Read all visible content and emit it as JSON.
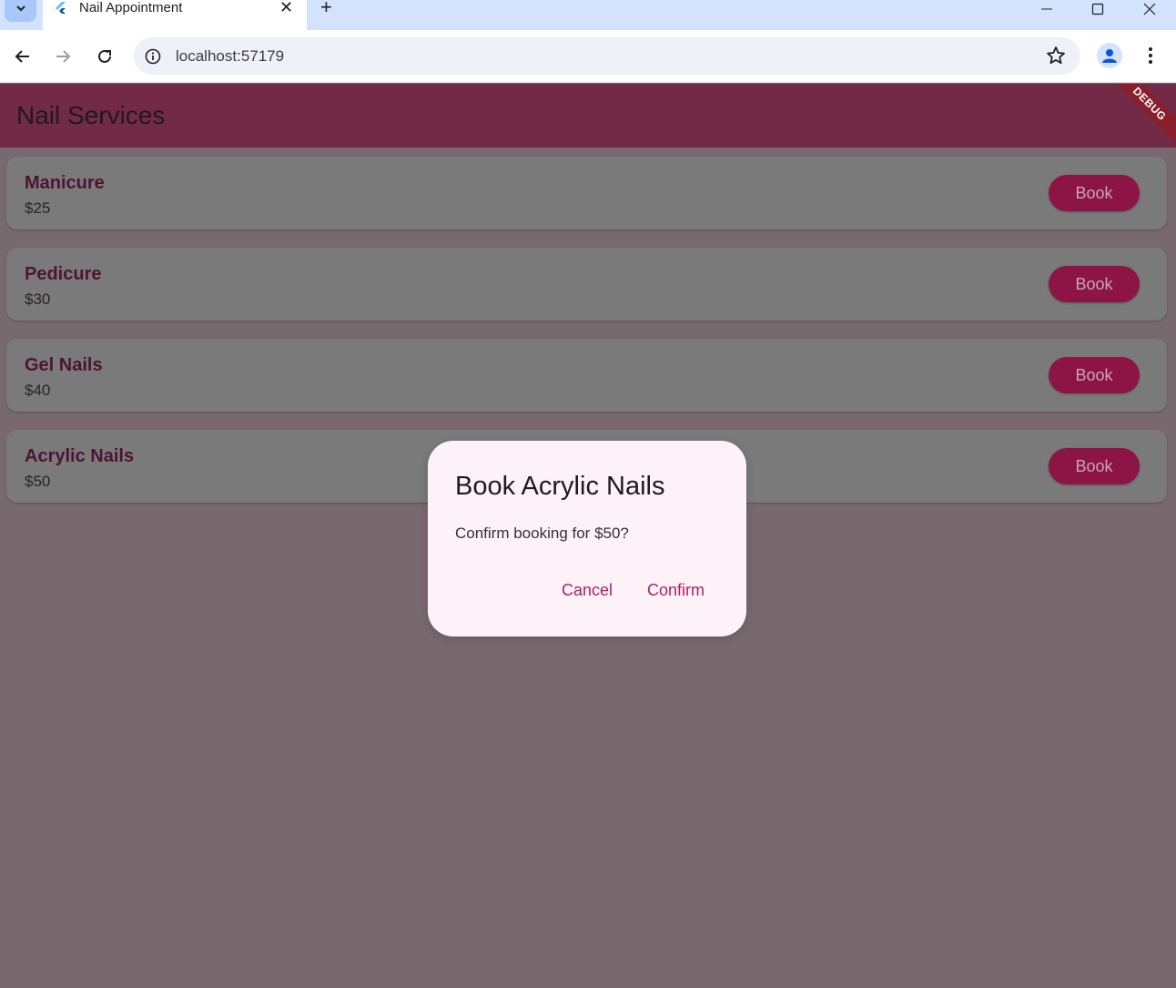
{
  "browser": {
    "tab_title": "Nail Appointment",
    "url": "localhost:57179",
    "icons": [
      "tab-search-icon",
      "flutter-favicon-icon",
      "close-icon",
      "plus-icon",
      "minimize-icon",
      "maximize-icon",
      "window-close-icon",
      "back-icon",
      "forward-icon",
      "reload-icon",
      "info-icon",
      "star-icon",
      "profile-icon",
      "menu-icon"
    ]
  },
  "app": {
    "title": "Nail Services",
    "debug_banner": "DEBUG",
    "colors": {
      "appbar": "#722a46",
      "button": "#8c1545",
      "accent": "#b0205e",
      "dialog": "#fdf2f8"
    }
  },
  "services": [
    {
      "name": "Manicure",
      "price": "$25",
      "button": "Book"
    },
    {
      "name": "Pedicure",
      "price": "$30",
      "button": "Book"
    },
    {
      "name": "Gel Nails",
      "price": "$40",
      "button": "Book"
    },
    {
      "name": "Acrylic Nails",
      "price": "$50",
      "button": "Book"
    }
  ],
  "dialog": {
    "title": "Book Acrylic Nails",
    "body": "Confirm booking for $50?",
    "cancel": "Cancel",
    "confirm": "Confirm"
  }
}
